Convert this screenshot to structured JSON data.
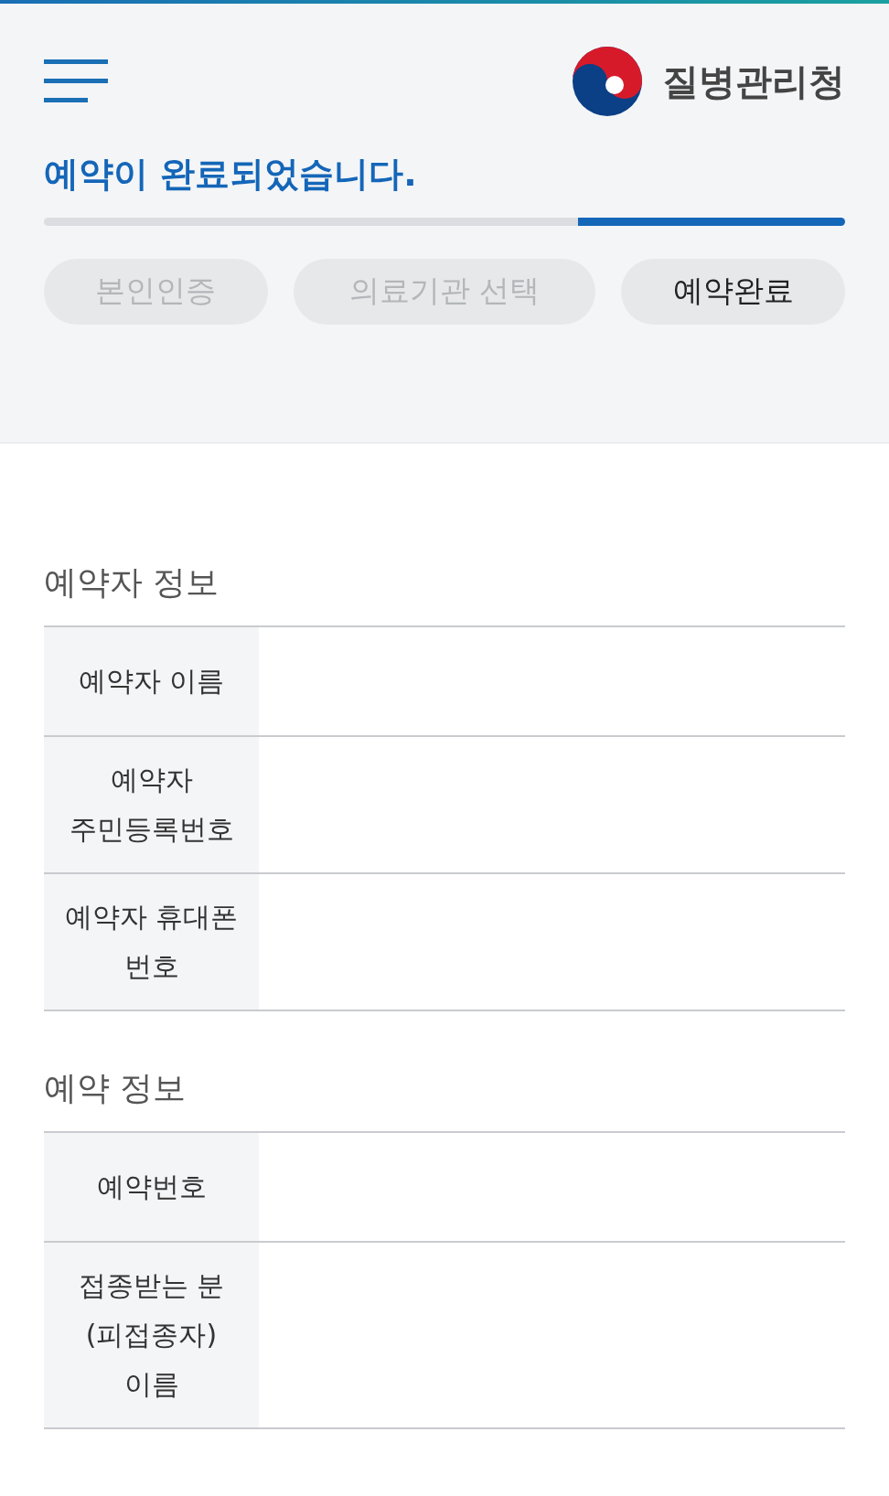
{
  "header": {
    "agency": "질병관리청"
  },
  "title": "예약이 완료되었습니다.",
  "steps": [
    {
      "label": "본인인증",
      "selected": false
    },
    {
      "label": "의료기관 선택",
      "selected": false
    },
    {
      "label": "예약완료",
      "selected": true
    }
  ],
  "sections": [
    {
      "title": "예약자 정보",
      "rows": [
        {
          "label": "예약자 이름"
        },
        {
          "label": "예약자 주민등록번호"
        },
        {
          "label": "예약자 휴대폰 번호"
        }
      ]
    },
    {
      "title": "예약 정보",
      "rows": [
        {
          "label": "예약번호"
        },
        {
          "label": "접종받는 분(피접종자) 이름"
        }
      ]
    }
  ]
}
